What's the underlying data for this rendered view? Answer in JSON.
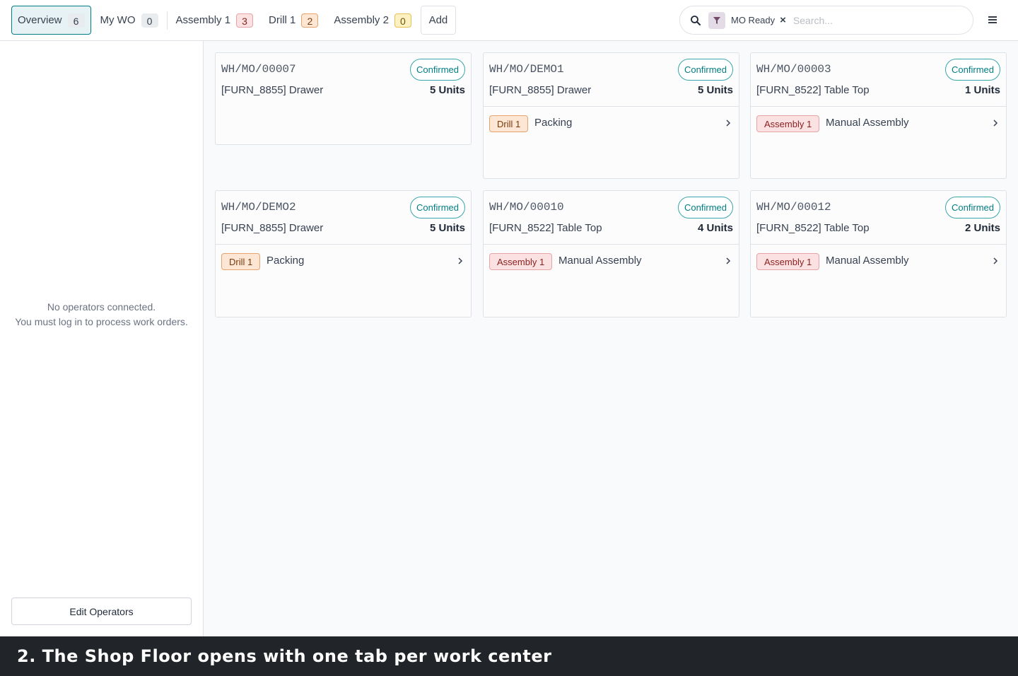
{
  "tabs": [
    {
      "label": "Overview",
      "count": "6",
      "color": "grey",
      "active": true
    },
    {
      "label": "My WO",
      "count": "0",
      "color": "grey"
    },
    {
      "label": "Assembly 1",
      "count": "3",
      "color": "red"
    },
    {
      "label": "Drill 1",
      "count": "2",
      "color": "orange"
    },
    {
      "label": "Assembly 2",
      "count": "0",
      "color": "yellow"
    }
  ],
  "add_label": "Add",
  "search": {
    "facet_label": "MO Ready",
    "facet_remove": "×",
    "placeholder": "Search..."
  },
  "sidebar": {
    "no_operators_line1": "No operators connected.",
    "no_operators_line2": "You must log in to process work orders.",
    "edit_operators_label": "Edit Operators"
  },
  "cards": [
    {
      "mo": "WH/MO/00007",
      "status": "Confirmed",
      "product": "[FURN_8855] Drawer",
      "qty": "5 Units",
      "workorders": []
    },
    {
      "mo": "WH/MO/DEMO1",
      "status": "Confirmed",
      "product": "[FURN_8855] Drawer",
      "qty": "5 Units",
      "workorders": [
        {
          "center": "Drill 1",
          "color": "orange",
          "name": "Packing"
        }
      ]
    },
    {
      "mo": "WH/MO/00003",
      "status": "Confirmed",
      "product": "[FURN_8522] Table Top",
      "qty": "1 Units",
      "workorders": [
        {
          "center": "Assembly 1",
          "color": "red",
          "name": "Manual Assembly"
        }
      ]
    },
    {
      "mo": "WH/MO/DEMO2",
      "status": "Confirmed",
      "product": "[FURN_8855] Drawer",
      "qty": "5 Units",
      "workorders": [
        {
          "center": "Drill 1",
          "color": "orange",
          "name": "Packing"
        }
      ]
    },
    {
      "mo": "WH/MO/00010",
      "status": "Confirmed",
      "product": "[FURN_8522] Table Top",
      "qty": "4 Units",
      "workorders": [
        {
          "center": "Assembly 1",
          "color": "red",
          "name": "Manual Assembly"
        }
      ]
    },
    {
      "mo": "WH/MO/00012",
      "status": "Confirmed",
      "product": "[FURN_8522] Table Top",
      "qty": "2 Units",
      "workorders": [
        {
          "center": "Assembly 1",
          "color": "red",
          "name": "Manual Assembly"
        }
      ]
    }
  ],
  "caption": "2. The Shop Floor opens with one tab per work center",
  "colors": {
    "accent": "#017e84",
    "caption_bg": "#212529"
  }
}
